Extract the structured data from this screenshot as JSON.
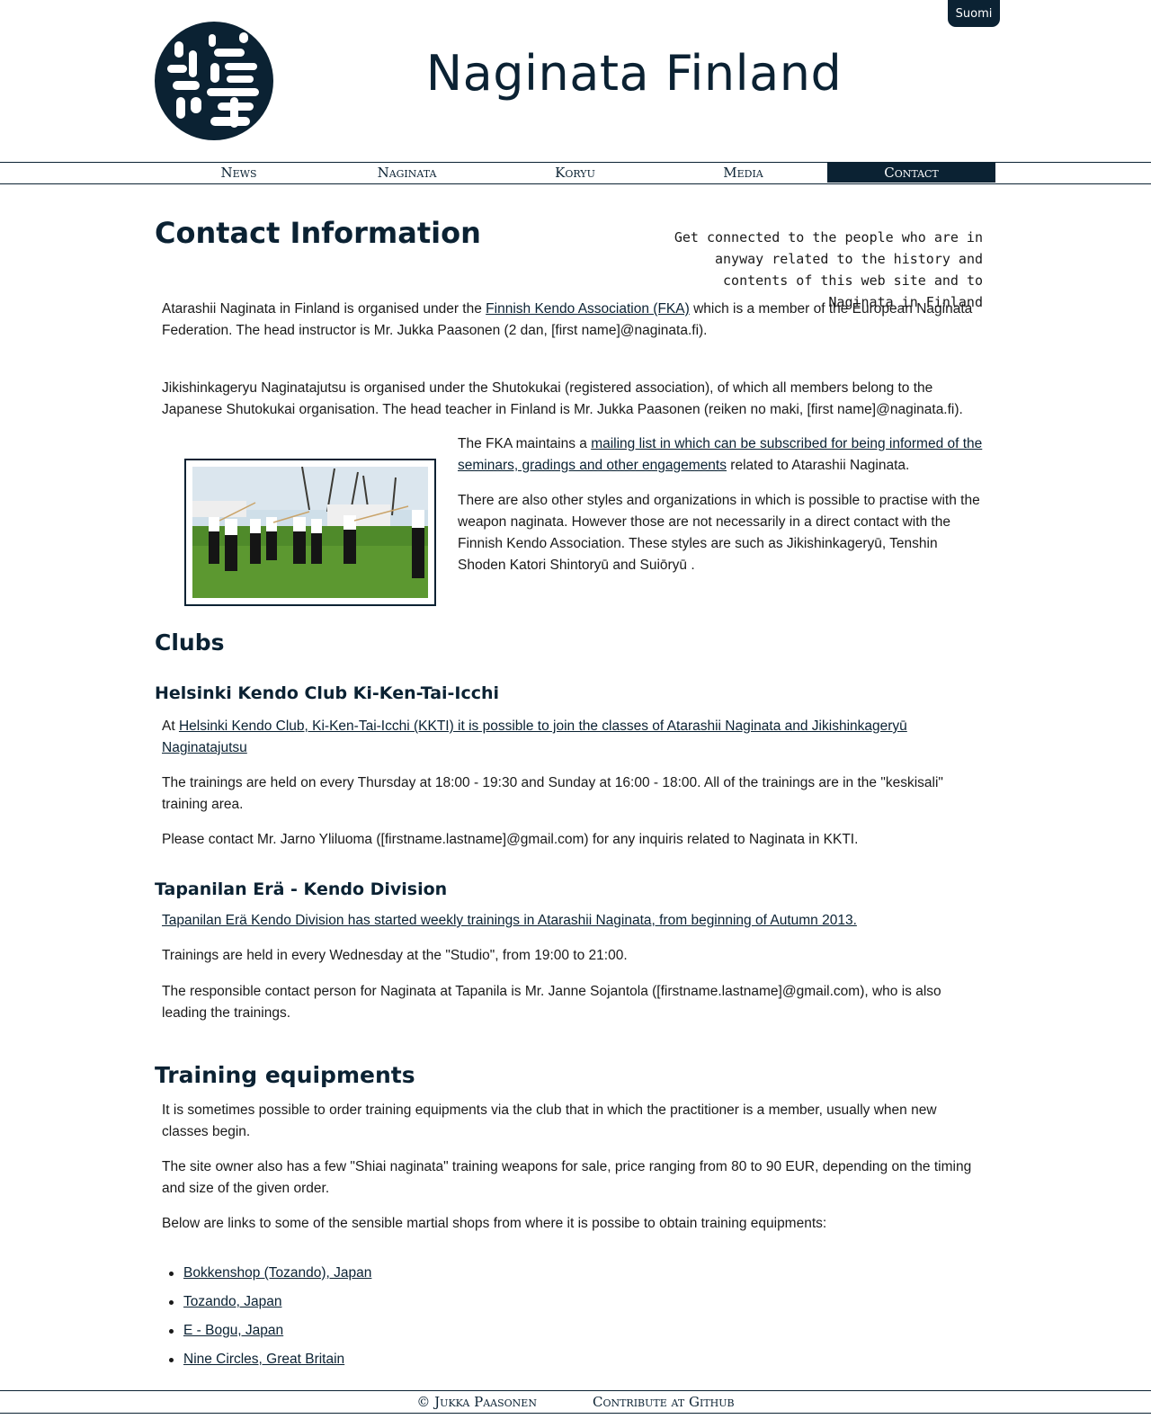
{
  "header": {
    "language_button": "Suomi",
    "site_title": "Naginata Finland",
    "logo_icon": "naginata-kanji-logo-icon"
  },
  "nav": {
    "items": [
      {
        "label": "News"
      },
      {
        "label": "Naginata"
      },
      {
        "label": "Koryu"
      },
      {
        "label": "Media"
      },
      {
        "label": "Contact"
      }
    ],
    "active": "Contact"
  },
  "main": {
    "title": "Contact Information",
    "tagline": "Get connected to the people who are in anyway related to the history and contents of this web site and to Naginata in Finland",
    "intro": {
      "p1_prefix": "Atarashii Naginata in Finland is organised under the ",
      "p1_link": "Finnish Kendo Association (FKA)",
      "p1_suffix": " which is a member of the European Naginata Federation. The head instructor is Mr. Jukka Paasonen (2 dan, [first name]@naginata.fi).",
      "p2": "Jikishinkageryu Naginatajutsu is organised under the Shutokukai (registered association), of which all members belong to the Japanese Shutokukai organisation. The head teacher in Finland is Mr. Jukka Paasonen (reiken no maki, [first name]@naginata.fi).",
      "p3_prefix": "The FKA maintains a ",
      "p3_link": "mailing list in which can be subscribed for being informed of the seminars, gradings and other engagements",
      "p3_suffix": " related to Atarashii Naginata.",
      "p4": "There are also other styles and organizations in which is possible to practise with the weapon naginata. However those are not necessarily in a direct contact with the Finnish Kendo Association. These styles are such as Jikishinkageryū, Tenshin Shoden Katori Shintoryū and Suiōryū ."
    },
    "clubs": {
      "title": "Clubs",
      "kkti": {
        "title": "Helsinki Kendo Club Ki-Ken-Tai-Icchi",
        "p1_prefix": "At ",
        "p1_link": "Helsinki Kendo Club, Ki-Ken-Tai-Icchi (KKTI) it is possible to join the classes of Atarashii Naginata and Jikishinkageryū Naginatajutsu",
        "p2": "The trainings are held on every Thursday at 18:00 - 19:30 and Sunday at 16:00 - 18:00. All of the trainings are in the \"keskisali\" training area.",
        "p3": "Please contact Mr. Jarno Yliluoma ([firstname.lastname]@gmail.com) for any inquiris related to Naginata in KKTI."
      },
      "tapanila": {
        "title": "Tapanilan Erä - Kendo Division",
        "p1_link": "Tapanilan Erä Kendo Division has started weekly trainings in Atarashii Naginata, from beginning of Autumn 2013.",
        "p2": "Trainings are held in every Wednesday at the \"Studio\", from 19:00 to 21:00.",
        "p3": "The responsible contact person for Naginata at Tapanila is Mr. Janne Sojantola ([firstname.lastname]@gmail.com), who is also leading the trainings."
      }
    },
    "equipment": {
      "title": "Training equipments",
      "p1": "It is sometimes possible to order training equipments via the club that in which the practitioner is a member, usually when new classes begin.",
      "p2": "The site owner also has a few \"Shiai naginata\" training weapons for sale, price ranging from 80 to 90 EUR, depending on the timing and size of the given order.",
      "p3": "Below are links to some of the sensible martial shops from where it is possibe to obtain training equipments:",
      "shops": [
        "Bokkenshop (Tozando), Japan",
        "Tozando, Japan",
        "E - Bogu, Japan",
        "Nine Circles, Great Britain"
      ]
    }
  },
  "footer": {
    "copyright": "© Jukka Paasonen",
    "contribute": "Contribute at Github"
  },
  "colors": {
    "brand": "#0b2233",
    "background": "#ffffff",
    "text": "#1a1a1a"
  }
}
